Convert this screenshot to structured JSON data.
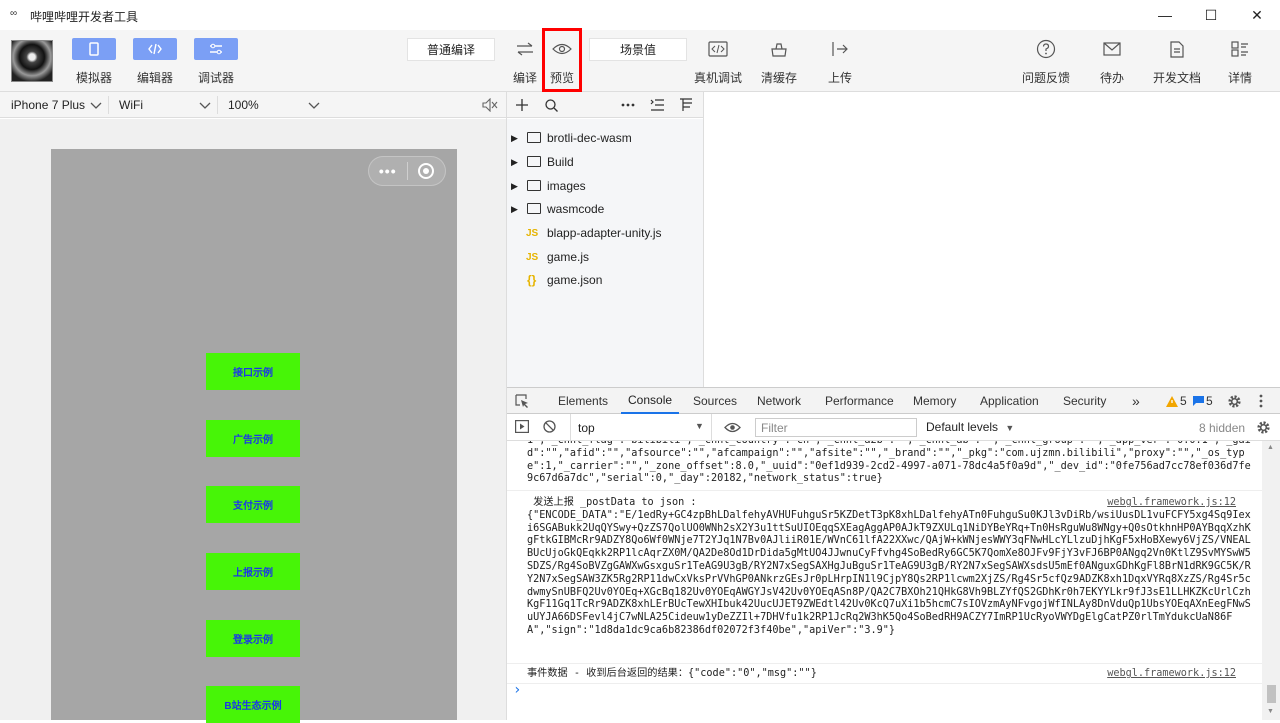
{
  "window": {
    "title": "哔哩哔哩开发者工具",
    "app_icon": "∞",
    "minimize": "—",
    "maximize": "☐",
    "close": "✕"
  },
  "toolbar": {
    "simulator_label": "模拟器",
    "editor_label": "编辑器",
    "debugger_label": "调试器",
    "compile_mode": "普通编译",
    "compile_label": "编译",
    "preview_label": "预览",
    "scene_value": "场景值",
    "real_device_label": "真机调试",
    "clear_cache_label": "清缓存",
    "upload_label": "上传",
    "feedback_label": "问题反馈",
    "todo_label": "待办",
    "dev_docs_label": "开发文档",
    "details_label": "详情"
  },
  "simulator": {
    "device": "iPhone 7 Plus",
    "network": "WiFi",
    "zoom": "100%",
    "buttons": [
      "接口示例",
      "广告示例",
      "支付示例",
      "上报示例",
      "登录示例",
      "B站生态示例"
    ]
  },
  "file_tree": {
    "items": [
      {
        "type": "folder",
        "name": "brotli-dec-wasm"
      },
      {
        "type": "folder",
        "name": "Build"
      },
      {
        "type": "folder",
        "name": "images"
      },
      {
        "type": "folder",
        "name": "wasmcode"
      },
      {
        "type": "js",
        "name": "blapp-adapter-unity.js"
      },
      {
        "type": "js",
        "name": "game.js"
      },
      {
        "type": "json",
        "name": "game.json"
      }
    ]
  },
  "devtools": {
    "tabs": [
      "Elements",
      "Console",
      "Sources",
      "Network",
      "Performance",
      "Memory",
      "Application",
      "Security"
    ],
    "active_tab": "Console",
    "more": "»",
    "warnings": "5",
    "messages": "5",
    "context": "top",
    "filter_placeholder": "Filter",
    "levels": "Default levels",
    "hidden": "8 hidden",
    "logs": [
      {
        "text": "1\",\"_chnl_flag\":\"bilibili\",\"_chnl_country\":\"cn\",\"_chnl_a2b\":\"\",\"_chnl_ab\":\"\",\"_chnl_group\":\"\",\"_app_ver\":\"0.0.1\",\"_gaid\":\"\",\"afid\":\"\",\"afsource\":\"\",\"afcampaign\":\"\",\"afsite\":\"\",\"_brand\":\"\",\"_pkg\":\"com.ujzmn.bilibili\",\"proxy\":\"\",\"_os_type\":1,\"_carrier\":\"\",\"_zone_offset\":8.0,\"_uuid\":\"0ef1d939-2cd2-4997-a071-78dc4a5f0a9d\",\"_dev_id\":\"0fe756ad7cc78ef036d7fe9c67d6a7dc\",\"serial\":0,\"_day\":20182,\"network_status\":true}",
        "source": ""
      },
      {
        "text": " 发送上报 _postData to json :\n{\"ENCODE_DATA\":\"E/1edRy+GC4zpBhLDalfehyAVHUFuhguSr5KZDetT3pK8xhLDalfehyATn0FuhguSu0KJl3vDiRb/wsiUusDL1vuFCFY5xg4Sq9Iexi6SGABukk2UqQYSwy+QzZS7QolUO0WNh2sX2Y3u1ttSuUIOEqqSXEagAggAP0AJkT9ZXULq1NiDYBeYRq+Tn0HsRguWu8WNgy+Q0sOtkhnHP0AYBqqXzhKgFtkGIBMcRr9ADZY8Qo6Wf0WNje7T2YJq1N7Bv0AJliiR01E/WVnC61lfA22XXwc/QAjW+kWNjesWWY3qFNwHLcYLlzuDjhKgF5xHoBXewy6VjZS/VNEALBUcUjoGkQEqkk2RP1lcAqrZX0M/QA2De8Od1DrDida5gMtUO4JJwnuCyFfvhg4SoBedRy6GC5K7QomXe8OJFv9FjY3vFJ6BP0ANgq2Vn0KtlZ9SvMYSwW5SDZS/Rg4SoBVZgGAWXwGsxguSr1TeAG9U3gB/RY2N7xSegSAXHgJuBguSr1TeAG9U3gB/RY2N7xSegSAWXsdsU5mEf0ANguxGDhKgFl8BrN1dRK9GC5K/RY2N7xSegSAW3ZK5Rg2RP11dwCxVksPrVVhGP0ANkrzGEsJr0pLHrpIN1l9CjpY8Qs2RP1lcwm2XjZS/Rg4Sr5cfQz9ADZK8xh1DqxVYRq8XzZS/Rg4Sr5cdwmySnUBFQ2Uv0YOEq+XGcBq182Uv0YOEqAWGYJsV42Uv0YOEqASn8P/QA2C7BXOh21QHkG8Vh9BLZYfQS2GDhKr0h7EKYYLkr9fJ3sE1LLHKZKcUrlCzhKgF11Gq1TcRr9ADZK8xhLErBUcTewXHIbuk42UucUJET9ZWEdtl42Uv0KcQ7uXi1b5hcmC7sIOVzmAyNFvgojWfINLAy8DnVduQp1UbsYOEqAXnEegFNwSuUYJA66DSFevl4jC7wNLA25Cideuw1yDeZZIl+7DHVfu1k2RP1JcRq2W3hK5Qo4SoBedRH9ACZY7ImRP1UcRyoVWYDgElgCatPZ0rlTmYdukcUaN86FA\",\"sign\":\"1d8da1dc9ca6b82386df02072f3f40be\",\"apiVer\":\"3.9\"}",
        "source": "webgl.framework.js:12"
      },
      {
        "text": "事件数据 - 收到后台返回的结果：{\"code\":\"0\",\"msg\":\"\"}",
        "source": "webgl.framework.js:12"
      }
    ],
    "prompt": "›"
  }
}
